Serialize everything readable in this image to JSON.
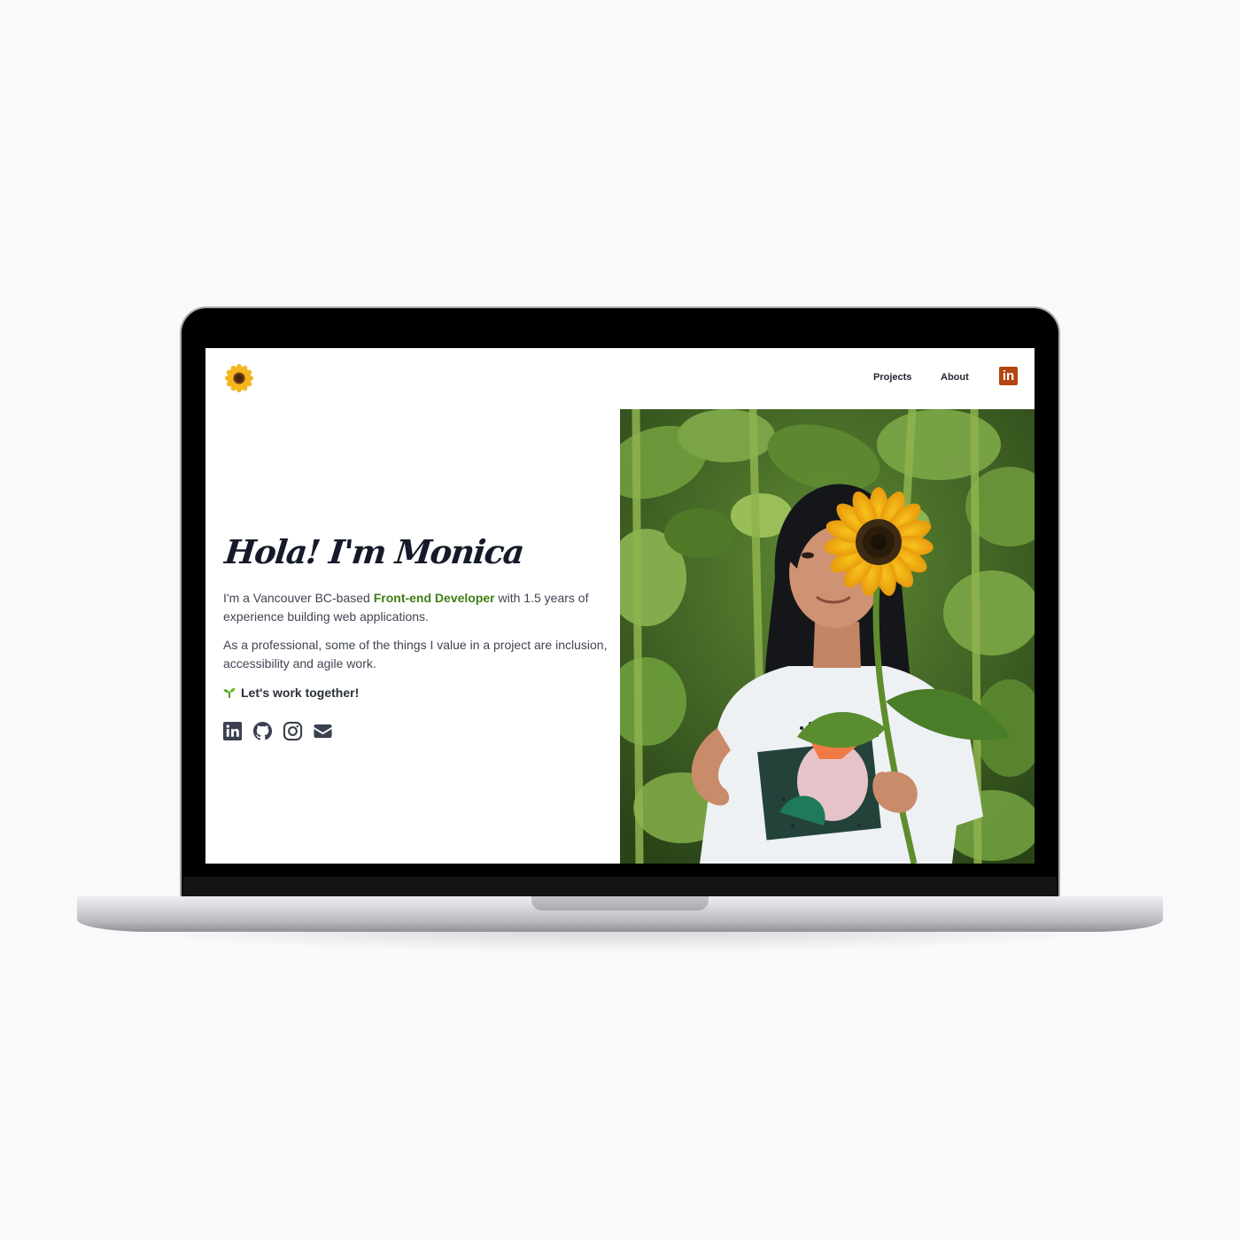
{
  "nav": {
    "logo_icon": "sunflower-icon",
    "links": [
      "Projects",
      "About"
    ],
    "linkedin_icon": "linkedin-icon",
    "linkedin_label": "in",
    "accent_color": "#b3470f"
  },
  "hero": {
    "title": "Hola! I'm Monica",
    "p1_before": "I'm a Vancouver BC-based ",
    "p1_highlight": "Front-end Developer",
    "p1_after": " with 1.5 years of experience building web applications.",
    "p2": "As a professional, some of the things I value in a project are inclusion, accessibility and agile work.",
    "cta": "Let's work together!",
    "cta_icon": "seedling-icon",
    "highlight_color": "#3f7d12"
  },
  "socials": [
    {
      "icon": "linkedin-icon"
    },
    {
      "icon": "github-icon"
    },
    {
      "icon": "instagram-icon"
    },
    {
      "icon": "email-icon"
    }
  ],
  "photo": {
    "subject": "woman holding sunflower in front of face in sunflower field"
  }
}
